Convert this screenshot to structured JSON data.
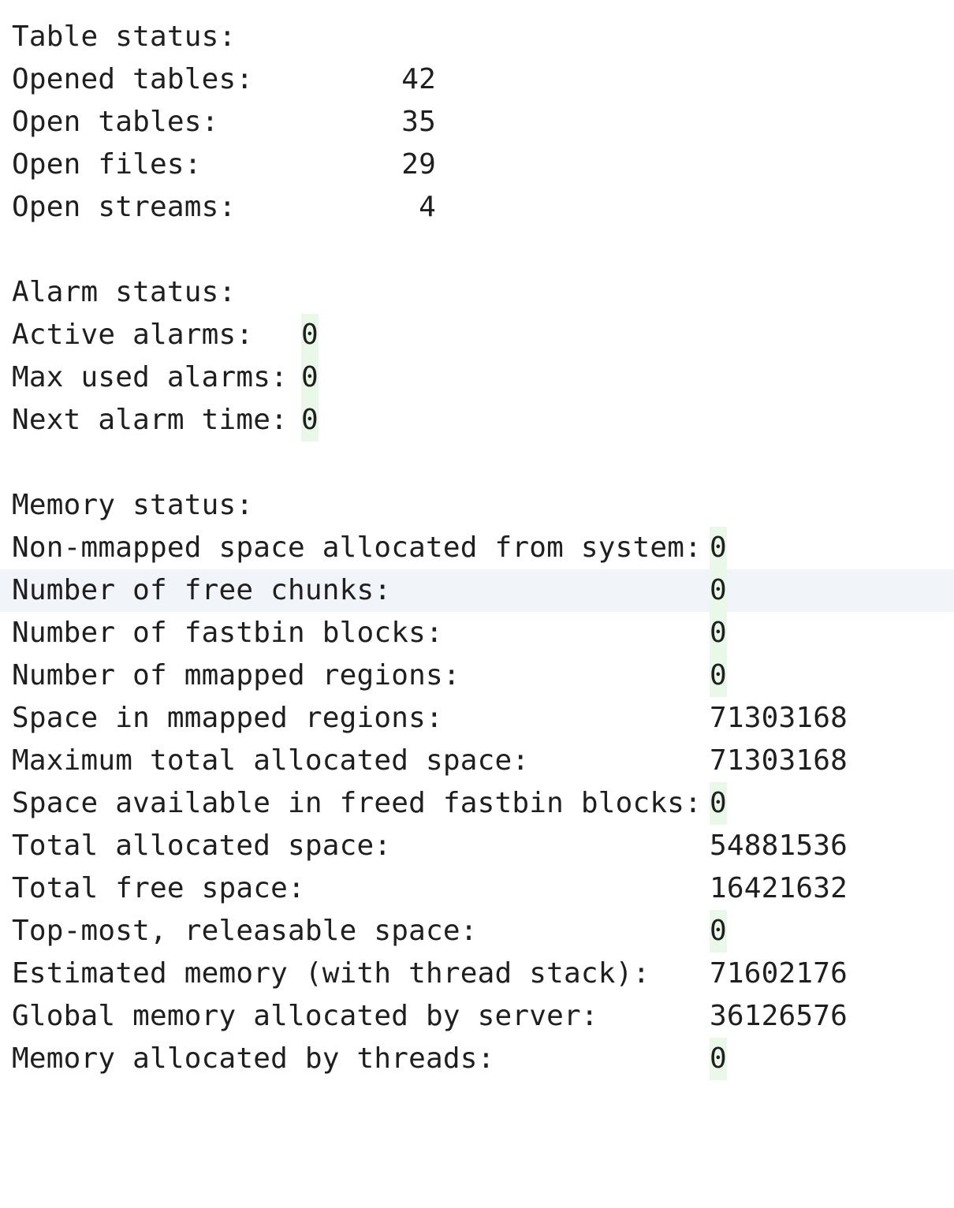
{
  "table_status": {
    "header": "Table status:",
    "rows": [
      {
        "label": "Opened tables:",
        "value": "42"
      },
      {
        "label": "Open tables:",
        "value": "35"
      },
      {
        "label": "Open files:",
        "value": "29"
      },
      {
        "label": "Open streams:",
        "value": "4"
      }
    ]
  },
  "alarm_status": {
    "header": "Alarm status:",
    "rows": [
      {
        "label": "Active alarms:",
        "value": "0"
      },
      {
        "label": "Max used alarms:",
        "value": "0"
      },
      {
        "label": "Next alarm time:",
        "value": "0"
      }
    ]
  },
  "memory_status": {
    "header": "Memory status:",
    "rows": [
      {
        "label": "Non-mmapped space allocated from system:",
        "value": "0"
      },
      {
        "label": "Number of free chunks:",
        "value": "0"
      },
      {
        "label": "Number of fastbin blocks:",
        "value": "0"
      },
      {
        "label": "Number of mmapped regions:",
        "value": "0"
      },
      {
        "label": "Space in mmapped regions:",
        "value": "71303168"
      },
      {
        "label": "Maximum total allocated space:",
        "value": "71303168"
      },
      {
        "label": "Space available in freed fastbin blocks:",
        "value": "0"
      },
      {
        "label": "Total allocated space:",
        "value": "54881536"
      },
      {
        "label": "Total free space:",
        "value": "16421632"
      },
      {
        "label": "Top-most, releasable space:",
        "value": "0"
      },
      {
        "label": "Estimated memory (with thread stack):",
        "value": "71602176"
      },
      {
        "label": "Global memory allocated by server:",
        "value": "36126576"
      },
      {
        "label": "Memory allocated by threads:",
        "value": "0"
      }
    ]
  },
  "colors": {
    "text": "#1f1f1f",
    "current_line": "#f1f4f8",
    "zero_highlight": "#e9f8e9"
  }
}
